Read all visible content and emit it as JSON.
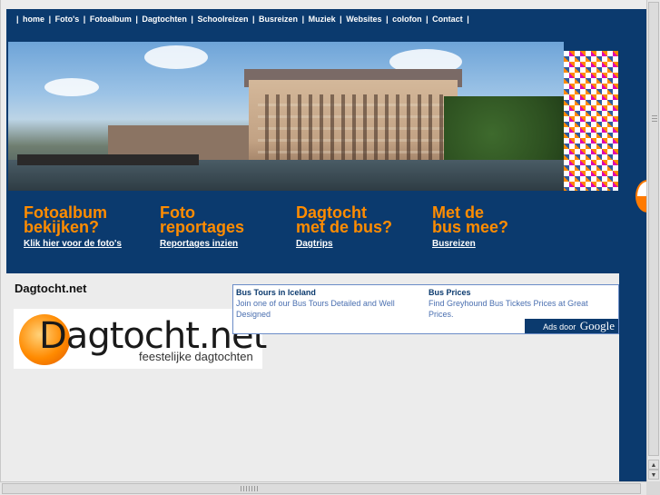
{
  "nav": {
    "items": [
      "home",
      "Foto's",
      "Fotoalbum",
      "Dagtochten",
      "Schoolreizen",
      "Busreizen",
      "Muziek",
      "Websites",
      "colofon",
      "Contact"
    ],
    "separator": "|"
  },
  "promos": [
    {
      "line1": "Fotoalbum",
      "line2": "bekijken?",
      "link": "Klik hier voor de foto's"
    },
    {
      "line1": "Foto",
      "line2": "reportages",
      "link": "Reportages inzien"
    },
    {
      "line1": "Dagtocht",
      "line2": "met de bus?",
      "link": "Dagtrips"
    },
    {
      "line1": "Met de",
      "line2": "bus mee?",
      "link": "Busreizen"
    }
  ],
  "page": {
    "heading": "Dagtocht.net"
  },
  "logo": {
    "word": "Dagtocht.net",
    "tagline": "feestelijke dagtochten"
  },
  "ads": {
    "items": [
      {
        "title": "Bus Tours in Iceland",
        "text": "Join one of our Bus Tours Detailed and Well Designed"
      },
      {
        "title": "Bus Prices",
        "text": "Find Greyhound Bus Tickets Prices at Great Prices."
      }
    ],
    "ads_by_label": "Ads door",
    "ads_by_brand": "Google"
  },
  "colors": {
    "header_blue": "#0b3a6e",
    "accent_orange": "#ff8c00",
    "page_bg": "#ececec"
  }
}
